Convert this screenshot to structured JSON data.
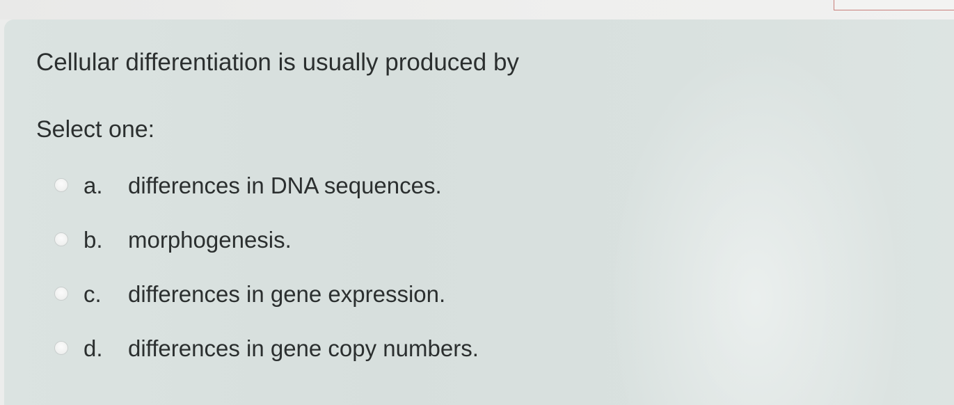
{
  "question": {
    "text": "Cellular differentiation is usually produced by",
    "prompt": "Select one:",
    "options": [
      {
        "letter": "a.",
        "text": "differences in DNA sequences."
      },
      {
        "letter": "b.",
        "text": "morphogenesis."
      },
      {
        "letter": "c.",
        "text": "differences in gene expression."
      },
      {
        "letter": "d.",
        "text": "differences in gene copy numbers."
      }
    ]
  },
  "colors": {
    "card_background": "#d9e1df",
    "text": "#2b2f2f",
    "page_background": "#ecedec"
  },
  "icons": {
    "radio": "radio-button-unselected"
  }
}
